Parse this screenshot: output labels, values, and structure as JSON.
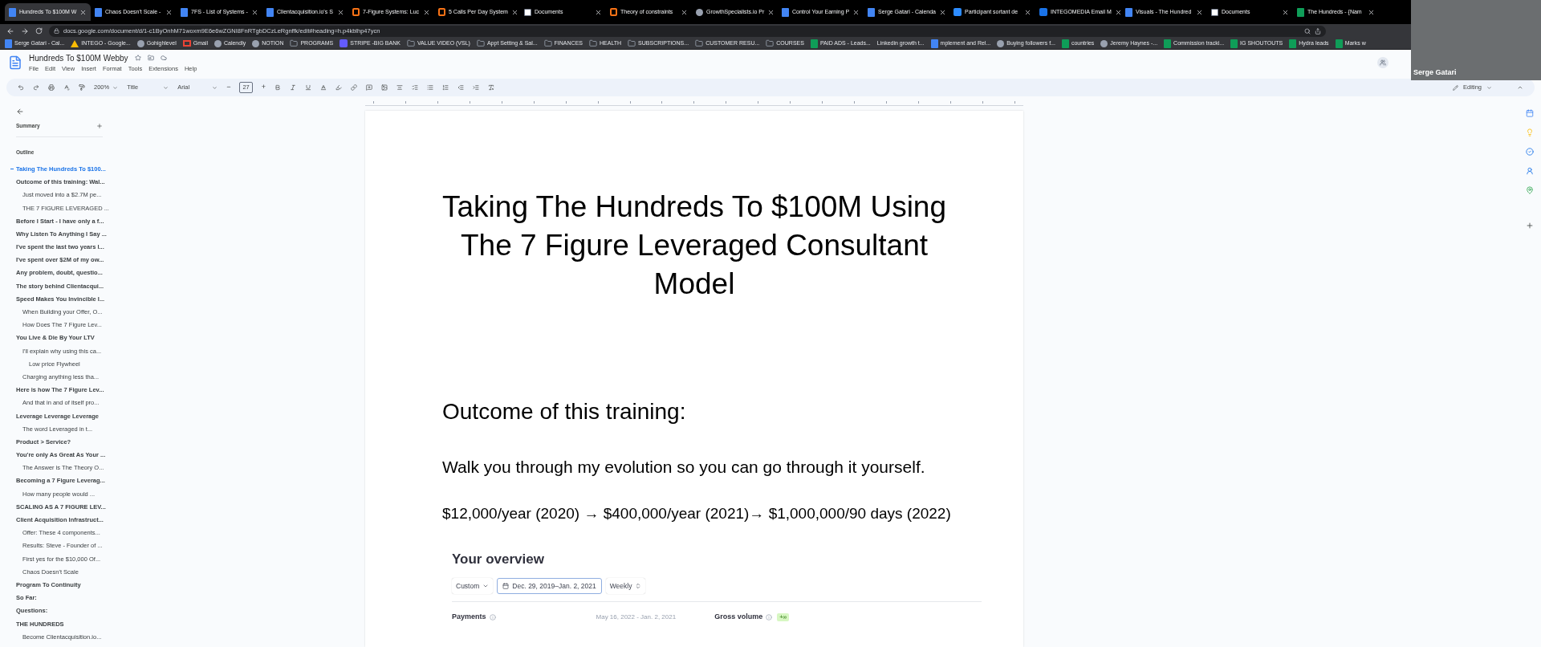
{
  "browser": {
    "tabs": [
      {
        "label": "Hundreds To $100M W",
        "kind": "doc",
        "selected": true
      },
      {
        "label": "Chaos Doesn't Scale -",
        "kind": "doc",
        "selected": false
      },
      {
        "label": "7FS - List of Systems -",
        "kind": "doc",
        "selected": false
      },
      {
        "label": "Clientacquisition.io's S",
        "kind": "doc",
        "selected": false
      },
      {
        "label": "7-Figure Systems: Luc",
        "kind": "hex",
        "selected": false
      },
      {
        "label": "5 Calls Per Day System",
        "kind": "hex",
        "selected": false
      },
      {
        "label": "Documents",
        "kind": "notion",
        "selected": false
      },
      {
        "label": "Theory of constraints",
        "kind": "hex",
        "selected": false
      },
      {
        "label": "GrowthSpecialists.io Pr",
        "kind": "generic",
        "selected": false
      },
      {
        "label": "Control Your Earning P",
        "kind": "doc",
        "selected": false
      },
      {
        "label": "Serge Gatari - Calenda",
        "kind": "doc",
        "selected": false
      },
      {
        "label": "Participant sortant de",
        "kind": "zoom",
        "selected": false
      },
      {
        "label": "INTEGOMEDIA Email M",
        "kind": "play",
        "selected": false
      },
      {
        "label": "Visuals - The Hundred",
        "kind": "doc",
        "selected": false
      },
      {
        "label": "Documents",
        "kind": "notion",
        "selected": false
      },
      {
        "label": "The Hundreds - {Nam",
        "kind": "sheet",
        "selected": false
      }
    ],
    "url": "docs.google.com/document/d/1-c1ByOnhM71woxm9E6e6wZGNI8FnRTgbDCzLeRgnffk/edit#heading=h.p4kblhp47ycn",
    "bookmarks": [
      {
        "label": "Serge Gatari - Cal...",
        "kind": "doc"
      },
      {
        "label": "INTEGO - Google...",
        "kind": "drive"
      },
      {
        "label": "Gohighlevel",
        "kind": "generic"
      },
      {
        "label": "Gmail",
        "kind": "mail"
      },
      {
        "label": "Calendly",
        "kind": "generic"
      },
      {
        "label": "NOTION",
        "kind": "generic"
      },
      {
        "label": "PROGRAMS",
        "kind": "folder"
      },
      {
        "label": "STRIPE -BIG BANK",
        "kind": "stripe"
      },
      {
        "label": "VALUE VIDEO (VSL)",
        "kind": "folder"
      },
      {
        "label": "Appt Setting & Sal...",
        "kind": "folder"
      },
      {
        "label": "FINANCES",
        "kind": "folder"
      },
      {
        "label": "HEALTH",
        "kind": "folder"
      },
      {
        "label": "SUBSCRIPTIONS...",
        "kind": "folder"
      },
      {
        "label": "CUSTOMER RESU...",
        "kind": "folder"
      },
      {
        "label": "COURSES",
        "kind": "folder"
      },
      {
        "label": "PAID ADS - Leads...",
        "kind": "sheet"
      },
      {
        "label": "Linkedin growth t...",
        "kind": "text"
      },
      {
        "label": "mplement and Rel...",
        "kind": "doc"
      },
      {
        "label": "Buying followers f...",
        "kind": "generic"
      },
      {
        "label": "countries",
        "kind": "sheet"
      },
      {
        "label": "Jeremy Haynes -...",
        "kind": "generic"
      },
      {
        "label": "Commission tracki...",
        "kind": "sheet"
      },
      {
        "label": "IG SHOUTOUTS",
        "kind": "sheet"
      },
      {
        "label": "Hydra leads",
        "kind": "sheet"
      },
      {
        "label": "Marks w",
        "kind": "sheet"
      }
    ]
  },
  "document": {
    "title": "Hundreds To $100M Webby",
    "menu": [
      "File",
      "Edit",
      "View",
      "Insert",
      "Format",
      "Tools",
      "Extensions",
      "Help"
    ],
    "toolbar": {
      "zoom": "200%",
      "style": "Title",
      "font": "Arial",
      "font_size": "27",
      "minus": "−",
      "plus": "+"
    },
    "mode": "Editing"
  },
  "sidebar": {
    "summary": "Summary",
    "outline_label": "Outline",
    "outline": [
      {
        "label": "Taking The Hundreds To $100...",
        "selected": true
      },
      {
        "label": "Outcome of this training: Wal...",
        "selected": false,
        "children": [
          {
            "label": "Just moved into a $2.7M pe...",
            "selected": false
          },
          {
            "label": "THE 7 FIGURE LEVERAGED ...",
            "selected": false
          }
        ]
      },
      {
        "label": "Before I Start - I have only a f...",
        "selected": false
      },
      {
        "label": "Why Listen To Anything I Say ...",
        "selected": false
      },
      {
        "label": "I've spent the last two years l...",
        "selected": false
      },
      {
        "label": "I've spent over $2M of my ow...",
        "selected": false
      },
      {
        "label": "Any problem, doubt, questio...",
        "selected": false
      },
      {
        "label": "The story behind Clientacqui...",
        "selected": false
      },
      {
        "label": "Speed Makes You Invincible I...",
        "selected": false,
        "children": [
          {
            "label": "When Building your Offer, O...",
            "selected": false
          },
          {
            "label": "How Does The 7 Figure Lev...",
            "selected": false
          }
        ]
      },
      {
        "label": "You Live & Die By Your LTV",
        "selected": false,
        "children": [
          {
            "label": "I'll explain why using this ca...",
            "selected": false,
            "children": [
              {
                "label": "Low price Flywheel",
                "selected": false
              }
            ]
          },
          {
            "label": "Charging anything less tha...",
            "selected": false
          }
        ]
      },
      {
        "label": "Here is how The 7 Figure Lev...",
        "selected": false,
        "children": [
          {
            "label": "And that in and of itself pro...",
            "selected": false
          }
        ]
      },
      {
        "label": "Leverage Leverage Leverage",
        "selected": false,
        "children": [
          {
            "label": "The word Leveraged in t...",
            "selected": false
          }
        ]
      },
      {
        "label": "Product > Service?",
        "selected": false
      },
      {
        "label": "You're only As Great As Your ...",
        "selected": false,
        "children": [
          {
            "label": "The Answer is The Theory O...",
            "selected": false
          }
        ]
      },
      {
        "label": "Becoming a 7 Figure Leverag...",
        "selected": false,
        "children": [
          {
            "label": "How many people would ...",
            "selected": false
          }
        ]
      },
      {
        "label": "SCALING AS A 7 FIGURE LEV...",
        "selected": false
      },
      {
        "label": "Client Acquisition Infrastruct...",
        "selected": false,
        "children": [
          {
            "label": "Offer: These 4 components...",
            "selected": false
          },
          {
            "label": "Results: Steve - Founder of ...",
            "selected": false
          },
          {
            "label": "First yes for the $10,000 Of...",
            "selected": false
          },
          {
            "label": "Chaos Doesn't Scale",
            "selected": false
          }
        ]
      },
      {
        "label": "Program To Continuity",
        "selected": false
      },
      {
        "label": "So Far:",
        "selected": false
      },
      {
        "label": "Questions:",
        "selected": false
      },
      {
        "label": "THE HUNDREDS",
        "selected": false,
        "children": [
          {
            "label": "Become Clientacquisition.io...",
            "selected": false
          }
        ]
      }
    ]
  },
  "page": {
    "title": "Taking The Hundreds To $100M Using The 7 Figure Leveraged Consultant Model",
    "heading": "Outcome of this training:",
    "paragraphs": [
      "Walk you through my evolution so you can go through it yourself.",
      "$12,000/year (2020) → $400,000/year (2021)→ $1,000,000/90 days (2022)"
    ],
    "overview": {
      "title": "Your overview",
      "range_type": "Custom",
      "date_range": "Dec. 29, 2019–Jan. 2, 2021",
      "interval": "Weekly",
      "payments": "Payments",
      "payments_range": "May 16, 2022 - Jan. 2, 2021",
      "gross_volume": "Gross volume",
      "gross_badge": "+∞"
    }
  },
  "video_call": {
    "name": "Serge Gatari"
  }
}
